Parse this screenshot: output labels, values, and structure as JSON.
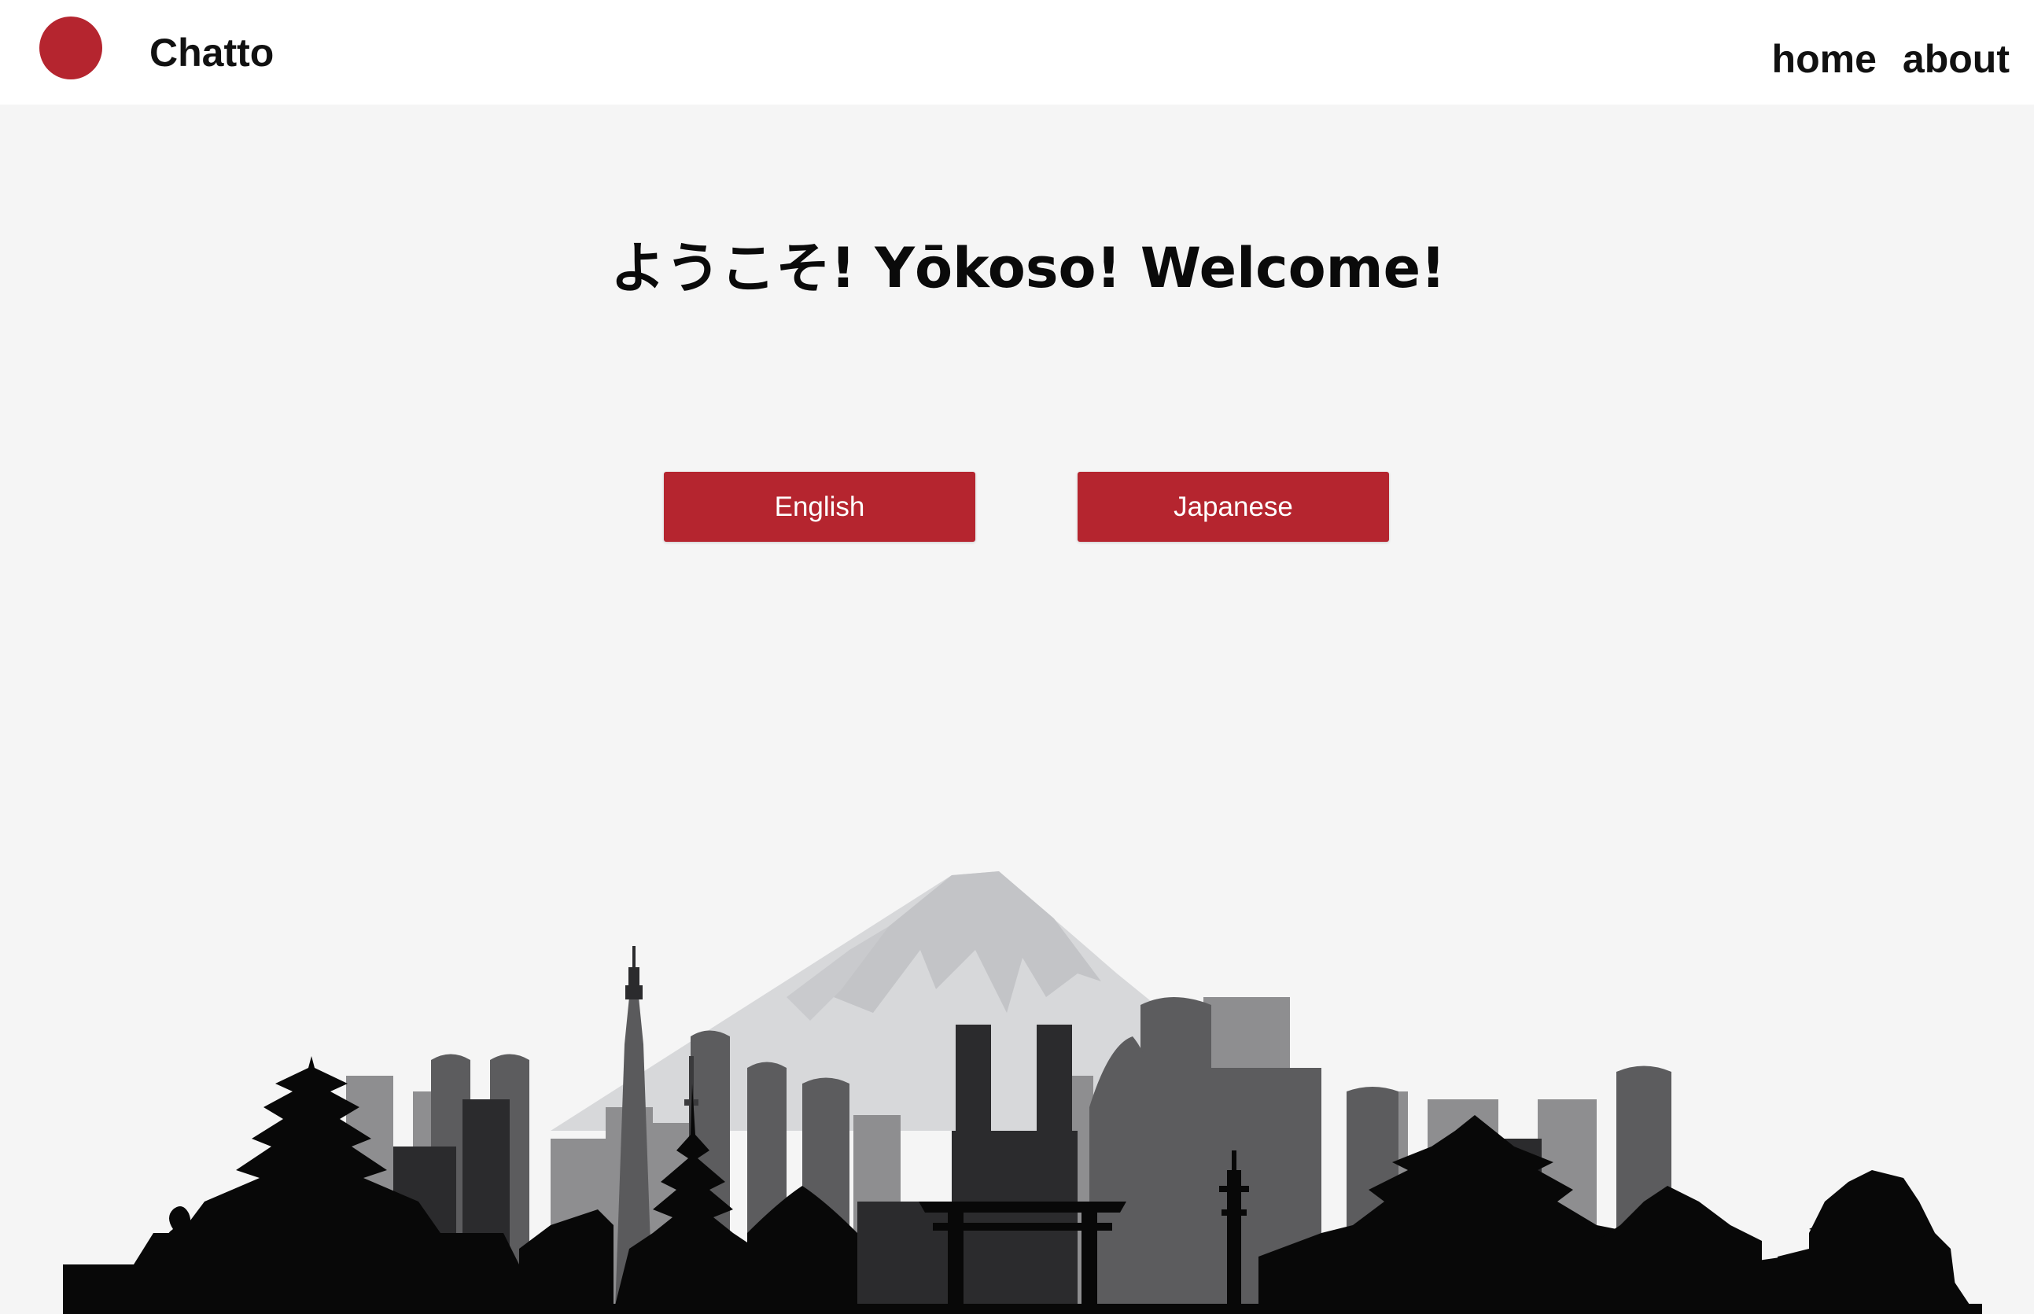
{
  "app": {
    "brand": "Chatto",
    "logo_color": "#b5252f"
  },
  "nav": {
    "links": [
      {
        "label": "home"
      },
      {
        "label": "about"
      }
    ]
  },
  "main": {
    "welcome_text": "ようこそ! Yōkoso! Welcome!",
    "buttons": {
      "english_label": "English",
      "japanese_label": "Japanese"
    },
    "accent_color": "#b5252f",
    "illustration": "tokyo-skyline-with-mount-fuji"
  }
}
